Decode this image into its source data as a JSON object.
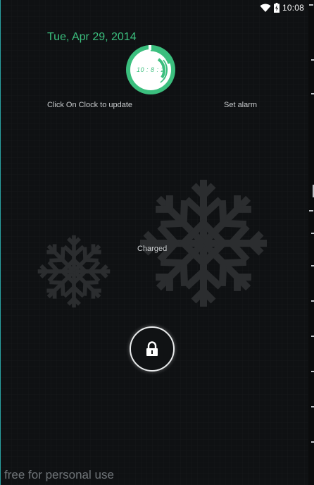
{
  "status_bar": {
    "time": "10:08",
    "icons": [
      "wifi-icon",
      "battery-charging-icon"
    ]
  },
  "lockscreen": {
    "date": "Tue, Apr 29, 2014",
    "clock_text": "10 : 8 : 2",
    "clock_hint": "Click On Clock to update",
    "set_alarm": "Set alarm",
    "battery_status": "Charged",
    "watermark": "free for personal use"
  },
  "colors": {
    "accent": "#3bbf7e",
    "background": "#0f1113",
    "snowflake": "#2b2d2f"
  },
  "icons": {
    "lock": "lock-icon",
    "snowflake_large": "snowflake-icon",
    "snowflake_small": "snowflake-icon"
  }
}
